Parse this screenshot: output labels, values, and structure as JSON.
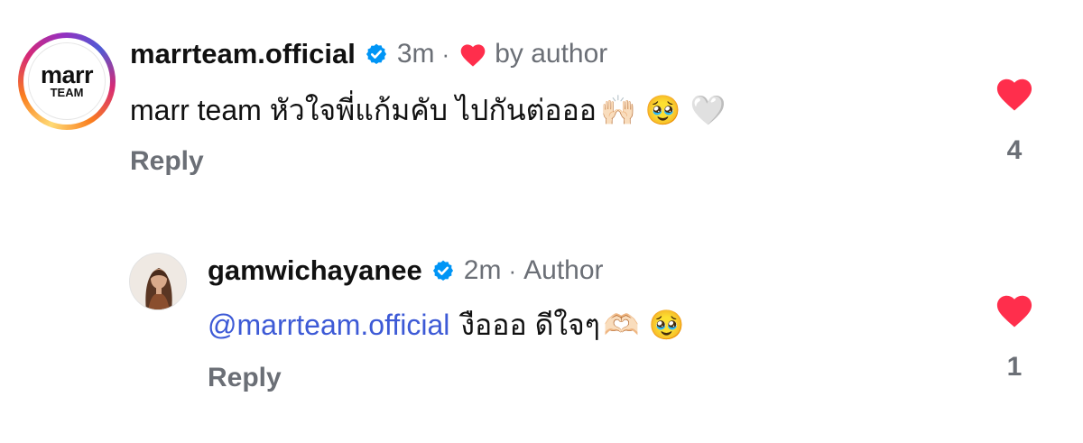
{
  "comments": [
    {
      "avatar": {
        "logo_top": "marr",
        "logo_bottom": "TEAM"
      },
      "username": "marrteam.official",
      "time": "3m",
      "separator": "·",
      "liked_by": "by author",
      "text": "marr team หัวใจพี่แก้มคับ ไปกันต่อออ",
      "emojis": [
        "🙌🏻",
        "🥹",
        "🤍"
      ],
      "reply_label": "Reply",
      "likes": "4"
    },
    {
      "username": "gamwichayanee",
      "time": "2m",
      "separator": "·",
      "author_label": "Author",
      "mention": "@marrteam.official",
      "text": "งือออ ดีใจๆ",
      "emojis": [
        "🫶🏻",
        "🥹"
      ],
      "reply_label": "Reply",
      "likes": "1"
    }
  ],
  "colors": {
    "heart_red": "#ff2e4c",
    "verified_blue": "#0095f6",
    "mention_blue": "#3d5ad6",
    "meta_gray": "#6b6f76"
  },
  "icons": [
    "verified-badge-icon",
    "heart-icon",
    "like-heart-icon"
  ]
}
